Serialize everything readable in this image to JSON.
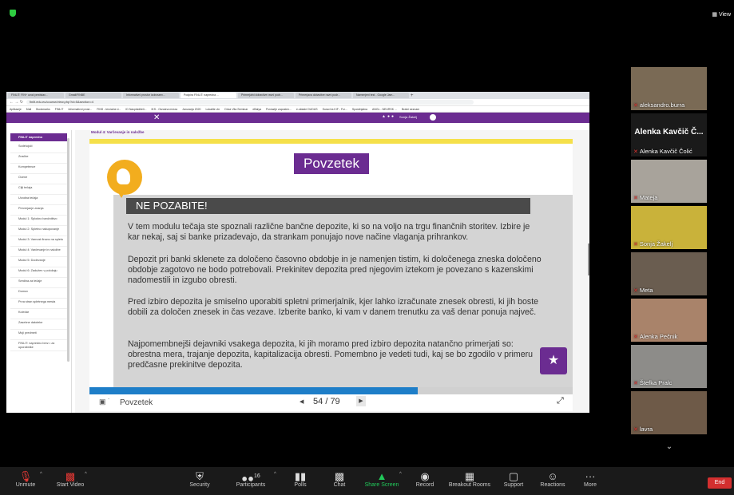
{
  "top": {
    "view_label": "View"
  },
  "browser": {
    "tabs": [
      "FINLIT: FIN+ uvod predstav...",
      "Gmail/FINBE",
      "Informativni prostor izobrazev...",
      "Podpira FINLIT: napredna ...",
      "Primerjalni dobavitve ravni podr...",
      "Primerjava dobavitve ravni podr...",
      "Namenjeni test - Google Jam..."
    ],
    "url": "finlit.edu.eu/course/view.php?id=5&section=4",
    "bookmarks": [
      "Aplikacije",
      "Mail",
      "Bookmarks",
      "FINLIT",
      "Informativni prost...",
      "FINS - tercialne d...",
      "ID Navpisiditeli...",
      "IKS - Osnutna mreza",
      "Janurarja 2020",
      "Lokatite vin",
      "Drica Vita Seminar",
      "eBalya",
      "Poviazlje zaposlen...",
      "e-sklade DUDUS",
      "Suravi ta KIF - Frz...",
      "Spositnjalna",
      "ANGL - NEURSK ...",
      "Bralni seznam"
    ],
    "user_name": "Sonja Žakelj"
  },
  "course": {
    "breadcrumb": "Modul 4: Varčevanje in naložbe",
    "sidebar_header": "FINLIT napredno",
    "sidebar_items": [
      "Sodelujoči",
      "Značke",
      "Kompetence",
      "Ocene",
      "Cilji tečaja",
      "Uvodna tečaja",
      "Preverjanje znanja",
      "Modul 1: Splošno bančništvo",
      "Modul 2: Spletno nakupovanje",
      "Modul 3: Varnost financ na spletu",
      "Modul 4: Varčevanje in naložbe",
      "Modul 5: Dodevanje",
      "Modul 6: Zadužen v položaju",
      "Sredina za tečaje",
      "Domov",
      "Prva stran spletnega mesta",
      "Koledar",
      "Zasebne datoteke",
      "Moji predmeti",
      "FINLIT: napredno brez • za uporabnike"
    ]
  },
  "slide": {
    "title": "Povzetek",
    "banner": "NE POZABITE!",
    "paragraphs": [
      "V tem modulu tečaja ste spoznali različne bančne depozite, ki so na voljo na trgu finančnih storitev. Izbire je kar nekaj, saj si banke prizadevajo, da strankam ponujajo nove načine vlaganja prihrankov.",
      "Depozit pri banki sklenete za določeno časovno obdobje in je namenjen tistim, ki določenega zneska določeno obdobje zagotovo ne bodo potrebovali. Prekinitev depozita pred njegovim iztekom je povezano s kazenskimi nadomestili in izgubo obresti.",
      "Pred izbiro depozita je smiselno uporabiti spletni primerjalnik, kjer lahko izračunate znesek obresti, ki jih boste dobili za določen znesek in čas vezave. Izberite banko, ki vam v danem trenutku za vaš denar ponuja največ.",
      "Najpomembnejši dejavniki vsakega depozita, ki jih moramo pred izbiro depozita natančno primerjati so: obrestna mera, trajanje depozita, kapitalizacija obresti. Pomembno je vedeti tudi, kaj se bo zgodilo v primeru predčasne prekinitve depozita."
    ],
    "progress": 0.68,
    "footer_title": "Povzetek",
    "page_current": "54",
    "page_sep": "/",
    "page_total": "79"
  },
  "participants": [
    {
      "name": "aleksandro.burra",
      "bg": "#7a6a55"
    },
    {
      "name": "Alenka Kavčič Čolić",
      "big_name": "Alenka Kavčič Č...",
      "bg": "#1a1a1a"
    },
    {
      "name": "Mateja",
      "bg": "#a8a39b"
    },
    {
      "name": "Sonja Žakelj",
      "bg": "#c9b23a"
    },
    {
      "name": "Meta",
      "bg": "#6a5d50"
    },
    {
      "name": "Alenka Pečnik",
      "bg": "#a9836a"
    },
    {
      "name": "Štefka Pralc",
      "bg": "#8d8c89"
    },
    {
      "name": "lavra",
      "bg": "#6e5a48"
    }
  ],
  "toolbar": {
    "unmute": "Unmute",
    "start_video": "Start Video",
    "security": "Security",
    "participants": "Participants",
    "participants_count": "16",
    "polls": "Polls",
    "chat": "Chat",
    "share_screen": "Share Screen",
    "record": "Record",
    "breakout": "Breakout Rooms",
    "support": "Support",
    "reactions": "Reactions",
    "more": "More",
    "end": "End"
  }
}
